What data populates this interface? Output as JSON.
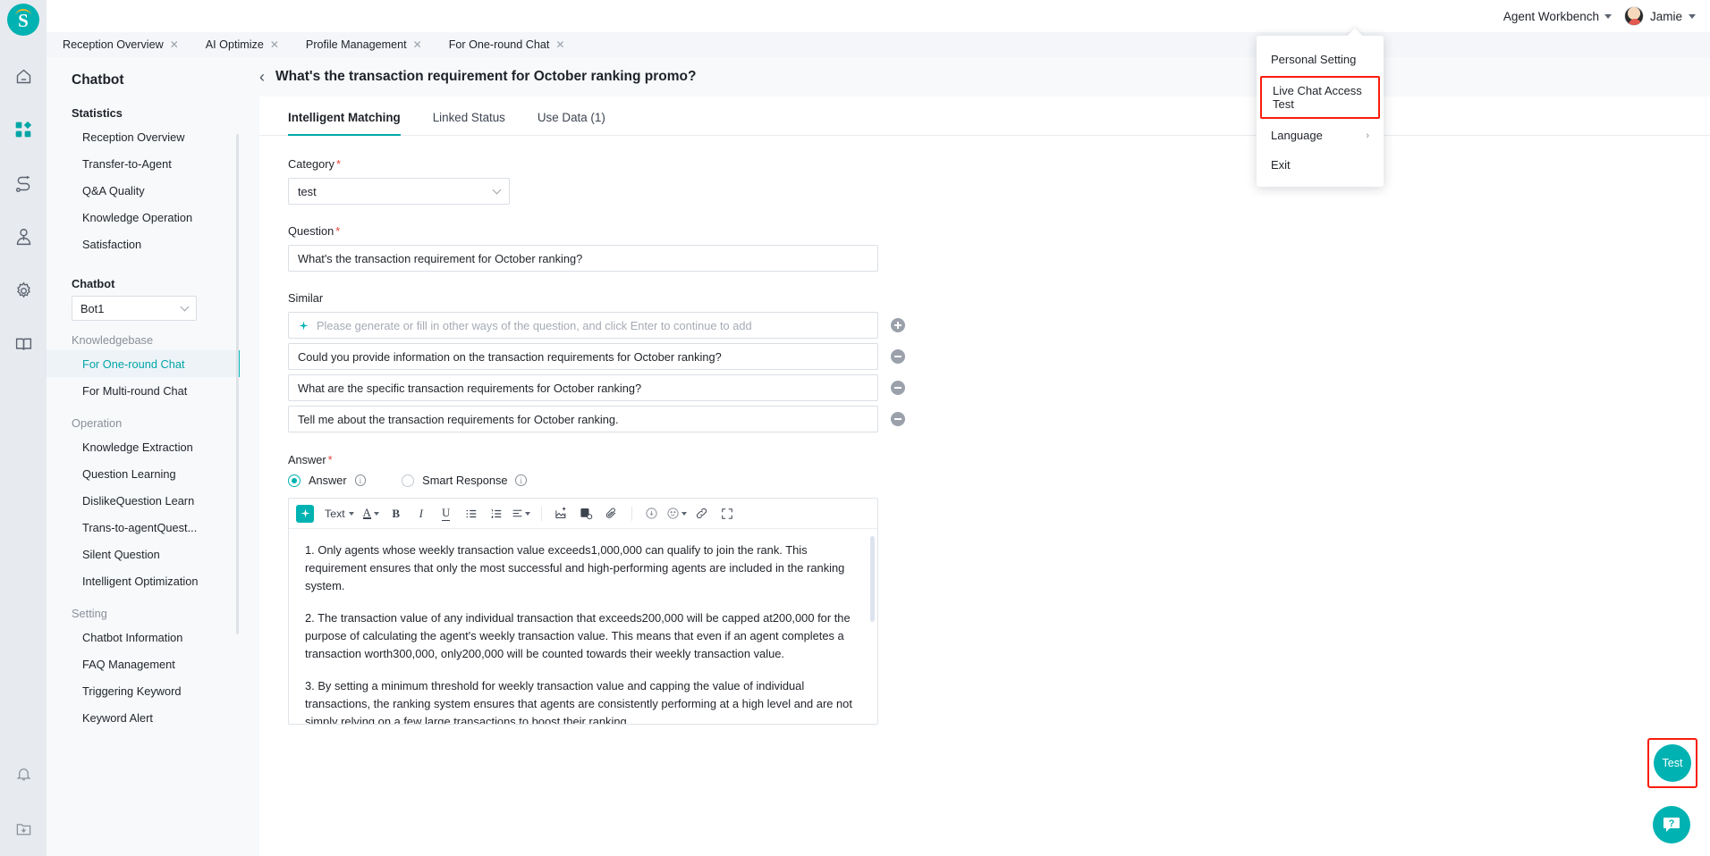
{
  "brand": {
    "logo_letter": "S",
    "accent": "#00b2b2",
    "highlight": "#f91c0b"
  },
  "topbar": {
    "workbench_label": "Agent Workbench",
    "user_name": "Jamie"
  },
  "browser_tabs": [
    {
      "label": "Reception Overview",
      "close": "✕"
    },
    {
      "label": "AI Optimize",
      "close": "✕"
    },
    {
      "label": "Profile Management",
      "close": "✕"
    },
    {
      "label": "For One-round Chat",
      "close": "✕"
    }
  ],
  "rail": {
    "icons": [
      "home-icon",
      "apps-icon",
      "flow-icon",
      "agent-icon",
      "gear-icon",
      "book-icon"
    ],
    "bottom_icons": [
      "bell-icon",
      "download-folder-icon"
    ]
  },
  "sidebar": {
    "title": "Chatbot",
    "statistics_header": "Statistics",
    "statistics_items": [
      "Reception Overview",
      "Transfer-to-Agent",
      "Q&A Quality",
      "Knowledge Operation",
      "Satisfaction"
    ],
    "chatbot_header": "Chatbot",
    "chatbot_select_value": "Bot1",
    "knowledgebase_header": "Knowledgebase",
    "knowledgebase_items": [
      {
        "label": "For One-round Chat",
        "active": true
      },
      {
        "label": "For Multi-round Chat",
        "active": false
      }
    ],
    "operation_header": "Operation",
    "operation_items": [
      "Knowledge Extraction",
      "Question Learning",
      "DislikeQuestion Learn",
      "Trans-to-agentQuest...",
      "Silent Question",
      "Intelligent Optimization"
    ],
    "setting_header": "Setting",
    "setting_items": [
      "Chatbot Information",
      "FAQ Management",
      "Triggering Keyword",
      "Keyword Alert"
    ]
  },
  "page": {
    "back_icon": "‹",
    "title": "What's the transaction requirement for October ranking promo?"
  },
  "tabs": [
    {
      "label": "Intelligent Matching",
      "active": true
    },
    {
      "label": "Linked Status",
      "active": false
    },
    {
      "label": "Use Data (1)",
      "active": false
    }
  ],
  "form": {
    "category_label": "Category",
    "category_value": "test",
    "question_label": "Question",
    "question_value": "What's the transaction requirement for October ranking?",
    "similar_label": "Similar",
    "similar_placeholder": "Please generate or fill in other ways of the question, and click Enter to continue to add",
    "similar_items": [
      "Could you provide information on the transaction requirements for October ranking?",
      "What are the specific transaction requirements for October ranking?",
      "Tell me about the transaction requirements for October ranking."
    ],
    "answer_label": "Answer",
    "answer_radio_label": "Answer",
    "smart_response_radio_label": "Smart Response",
    "required_mark": "*"
  },
  "editor": {
    "ai_icon": "sparkle-icon",
    "style_label": "Text",
    "buttons": [
      "font-color-icon",
      "bold-icon",
      "italic-icon",
      "underline-icon",
      "bullet-list-icon",
      "numbered-list-icon",
      "align-icon",
      "insert-image-icon",
      "insert-video-icon",
      "attachment-icon",
      "insert-media-icon",
      "emoji-icon",
      "link-icon",
      "fullscreen-icon"
    ],
    "paragraphs": [
      "1. Only agents whose weekly transaction value exceeds1,000,000 can qualify to join the rank. This requirement ensures that only the most successful and high-performing agents are included in the ranking system.",
      "2. The transaction value of any individual transaction that exceeds200,000 will be capped at200,000 for the purpose of calculating the agent's weekly transaction value. This means that even if an agent completes a transaction worth300,000, only200,000 will be counted towards their weekly transaction value.",
      "3. By setting a minimum threshold for weekly transaction value and capping the value of individual transactions, the ranking system ensures that agents are consistently performing at a high level and are not simply relying on a few large transactions to boost their ranking."
    ]
  },
  "user_menu": {
    "items": [
      {
        "label": "Personal Setting",
        "highlighted": false,
        "chevron": ""
      },
      {
        "label": "Live Chat Access Test",
        "highlighted": true,
        "chevron": ""
      },
      {
        "label": "Language",
        "highlighted": false,
        "chevron": "›"
      },
      {
        "label": "Exit",
        "highlighted": false,
        "chevron": ""
      }
    ]
  },
  "floating": {
    "test_label": "Test",
    "help_label": "?"
  }
}
